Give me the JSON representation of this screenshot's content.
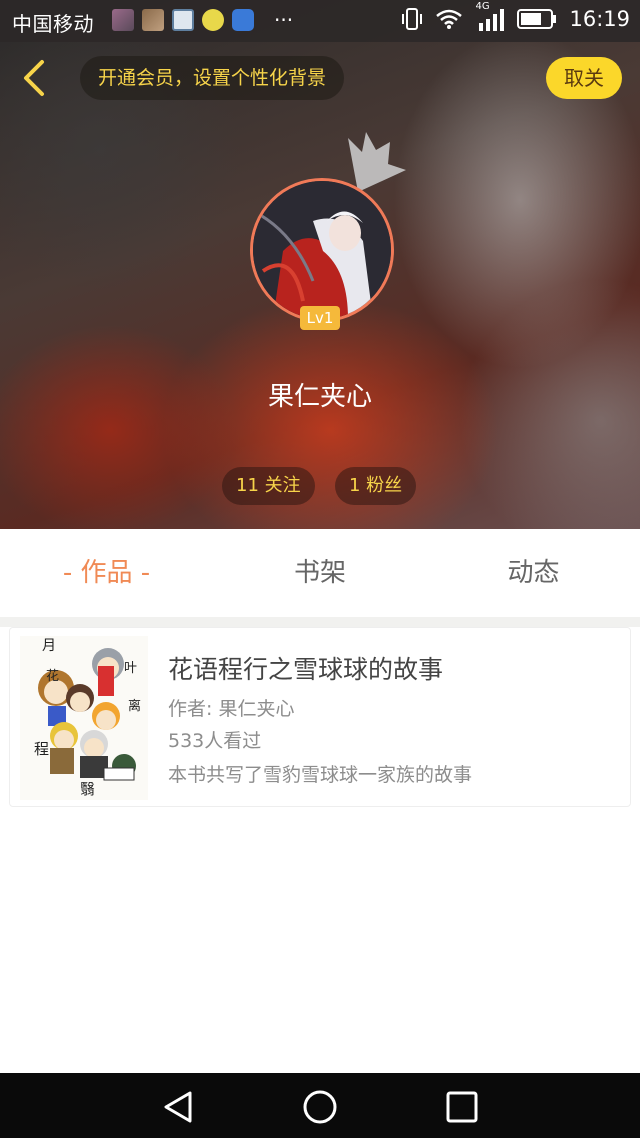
{
  "status_bar": {
    "carrier": "中国移动",
    "more": "···",
    "network": "4G",
    "time": "16:19"
  },
  "header": {
    "vip_banner": "开通会员，设置个性化背景",
    "unfollow_label": "取关"
  },
  "profile": {
    "level": "Lv1",
    "username": "果仁夹心",
    "following": "11 关注",
    "followers": "1 粉丝"
  },
  "tabs": [
    {
      "label": "- 作品 -",
      "active": true
    },
    {
      "label": "书架",
      "active": false
    },
    {
      "label": "动态",
      "active": false
    }
  ],
  "works": [
    {
      "title": "花语程行之雪球球的故事",
      "author": "作者: 果仁夹心",
      "views": "533人看过",
      "summary": "本书共写了雪豹雪球球一家族的故事",
      "cover_text": [
        "月",
        "花",
        "叶",
        "离",
        "程",
        "翳"
      ]
    }
  ],
  "colors": {
    "accent_tab": "#f08a55",
    "vip_text": "#f7d44a",
    "unfollow_bg": "#fbd72a",
    "level_badge": "#f5b93a"
  },
  "icons": {
    "back": "chevron-left-icon",
    "crown": "crown-icon",
    "nav_back": "triangle-back-icon",
    "nav_home": "circle-home-icon",
    "nav_recent": "square-recent-icon"
  }
}
